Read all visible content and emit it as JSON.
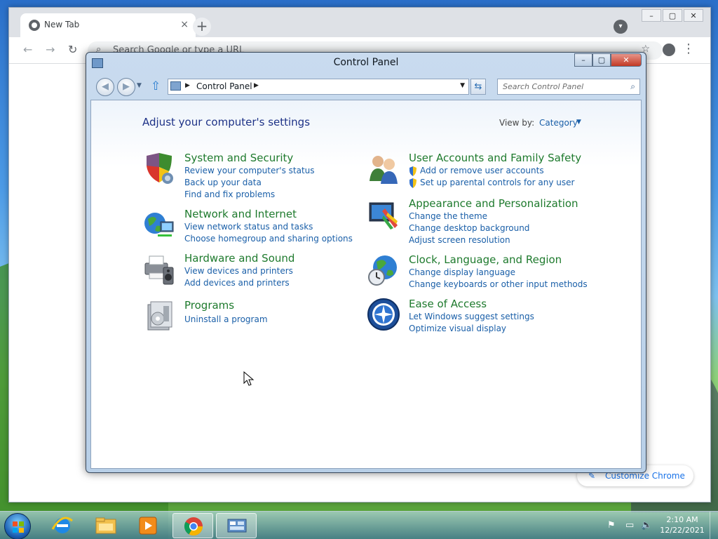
{
  "chrome": {
    "tab_title": "New Tab",
    "tab_close": "×",
    "new_tab": "+",
    "omnibox_placeholder": "Search Google or type a URL",
    "customize_label": "Customize Chrome",
    "win_minimize": "–",
    "win_maximize": "▢",
    "win_close": "✕"
  },
  "control_panel": {
    "title": "Control Panel",
    "address_crumb": "Control Panel",
    "search_placeholder": "Search Control Panel",
    "heading": "Adjust your computer's settings",
    "view_by_label": "View by:",
    "view_by_value": "Category",
    "win_minimize": "–",
    "win_maximize": "▢",
    "win_close": "✕",
    "categories": [
      {
        "title": "System and Security",
        "icon": "shield-icon",
        "links": [
          "Review your computer's status",
          "Back up your data",
          "Find and fix problems"
        ]
      },
      {
        "title": "Network and Internet",
        "icon": "globe-network-icon",
        "links": [
          "View network status and tasks",
          "Choose homegroup and sharing options"
        ]
      },
      {
        "title": "Hardware and Sound",
        "icon": "printer-speaker-icon",
        "links": [
          "View devices and printers",
          "Add devices and printers"
        ]
      },
      {
        "title": "Programs",
        "icon": "programs-box-icon",
        "links": [
          "Uninstall a program"
        ]
      },
      {
        "title": "User Accounts and Family Safety",
        "icon": "users-icon",
        "links": [
          "Add or remove user accounts",
          "Set up parental controls for any user"
        ]
      },
      {
        "title": "Appearance and Personalization",
        "icon": "monitor-paint-icon",
        "links": [
          "Change the theme",
          "Change desktop background",
          "Adjust screen resolution"
        ]
      },
      {
        "title": "Clock, Language, and Region",
        "icon": "globe-clock-icon",
        "links": [
          "Change display language",
          "Change keyboards or other input methods"
        ]
      },
      {
        "title": "Ease of Access",
        "icon": "ease-of-access-icon",
        "links": [
          "Let Windows suggest settings",
          "Optimize visual display"
        ]
      }
    ]
  },
  "taskbar": {
    "time": "2:10 AM",
    "date": "12/22/2021",
    "pinned": [
      "internet-explorer-icon",
      "file-explorer-icon",
      "media-player-icon",
      "chrome-icon",
      "control-panel-icon"
    ]
  }
}
